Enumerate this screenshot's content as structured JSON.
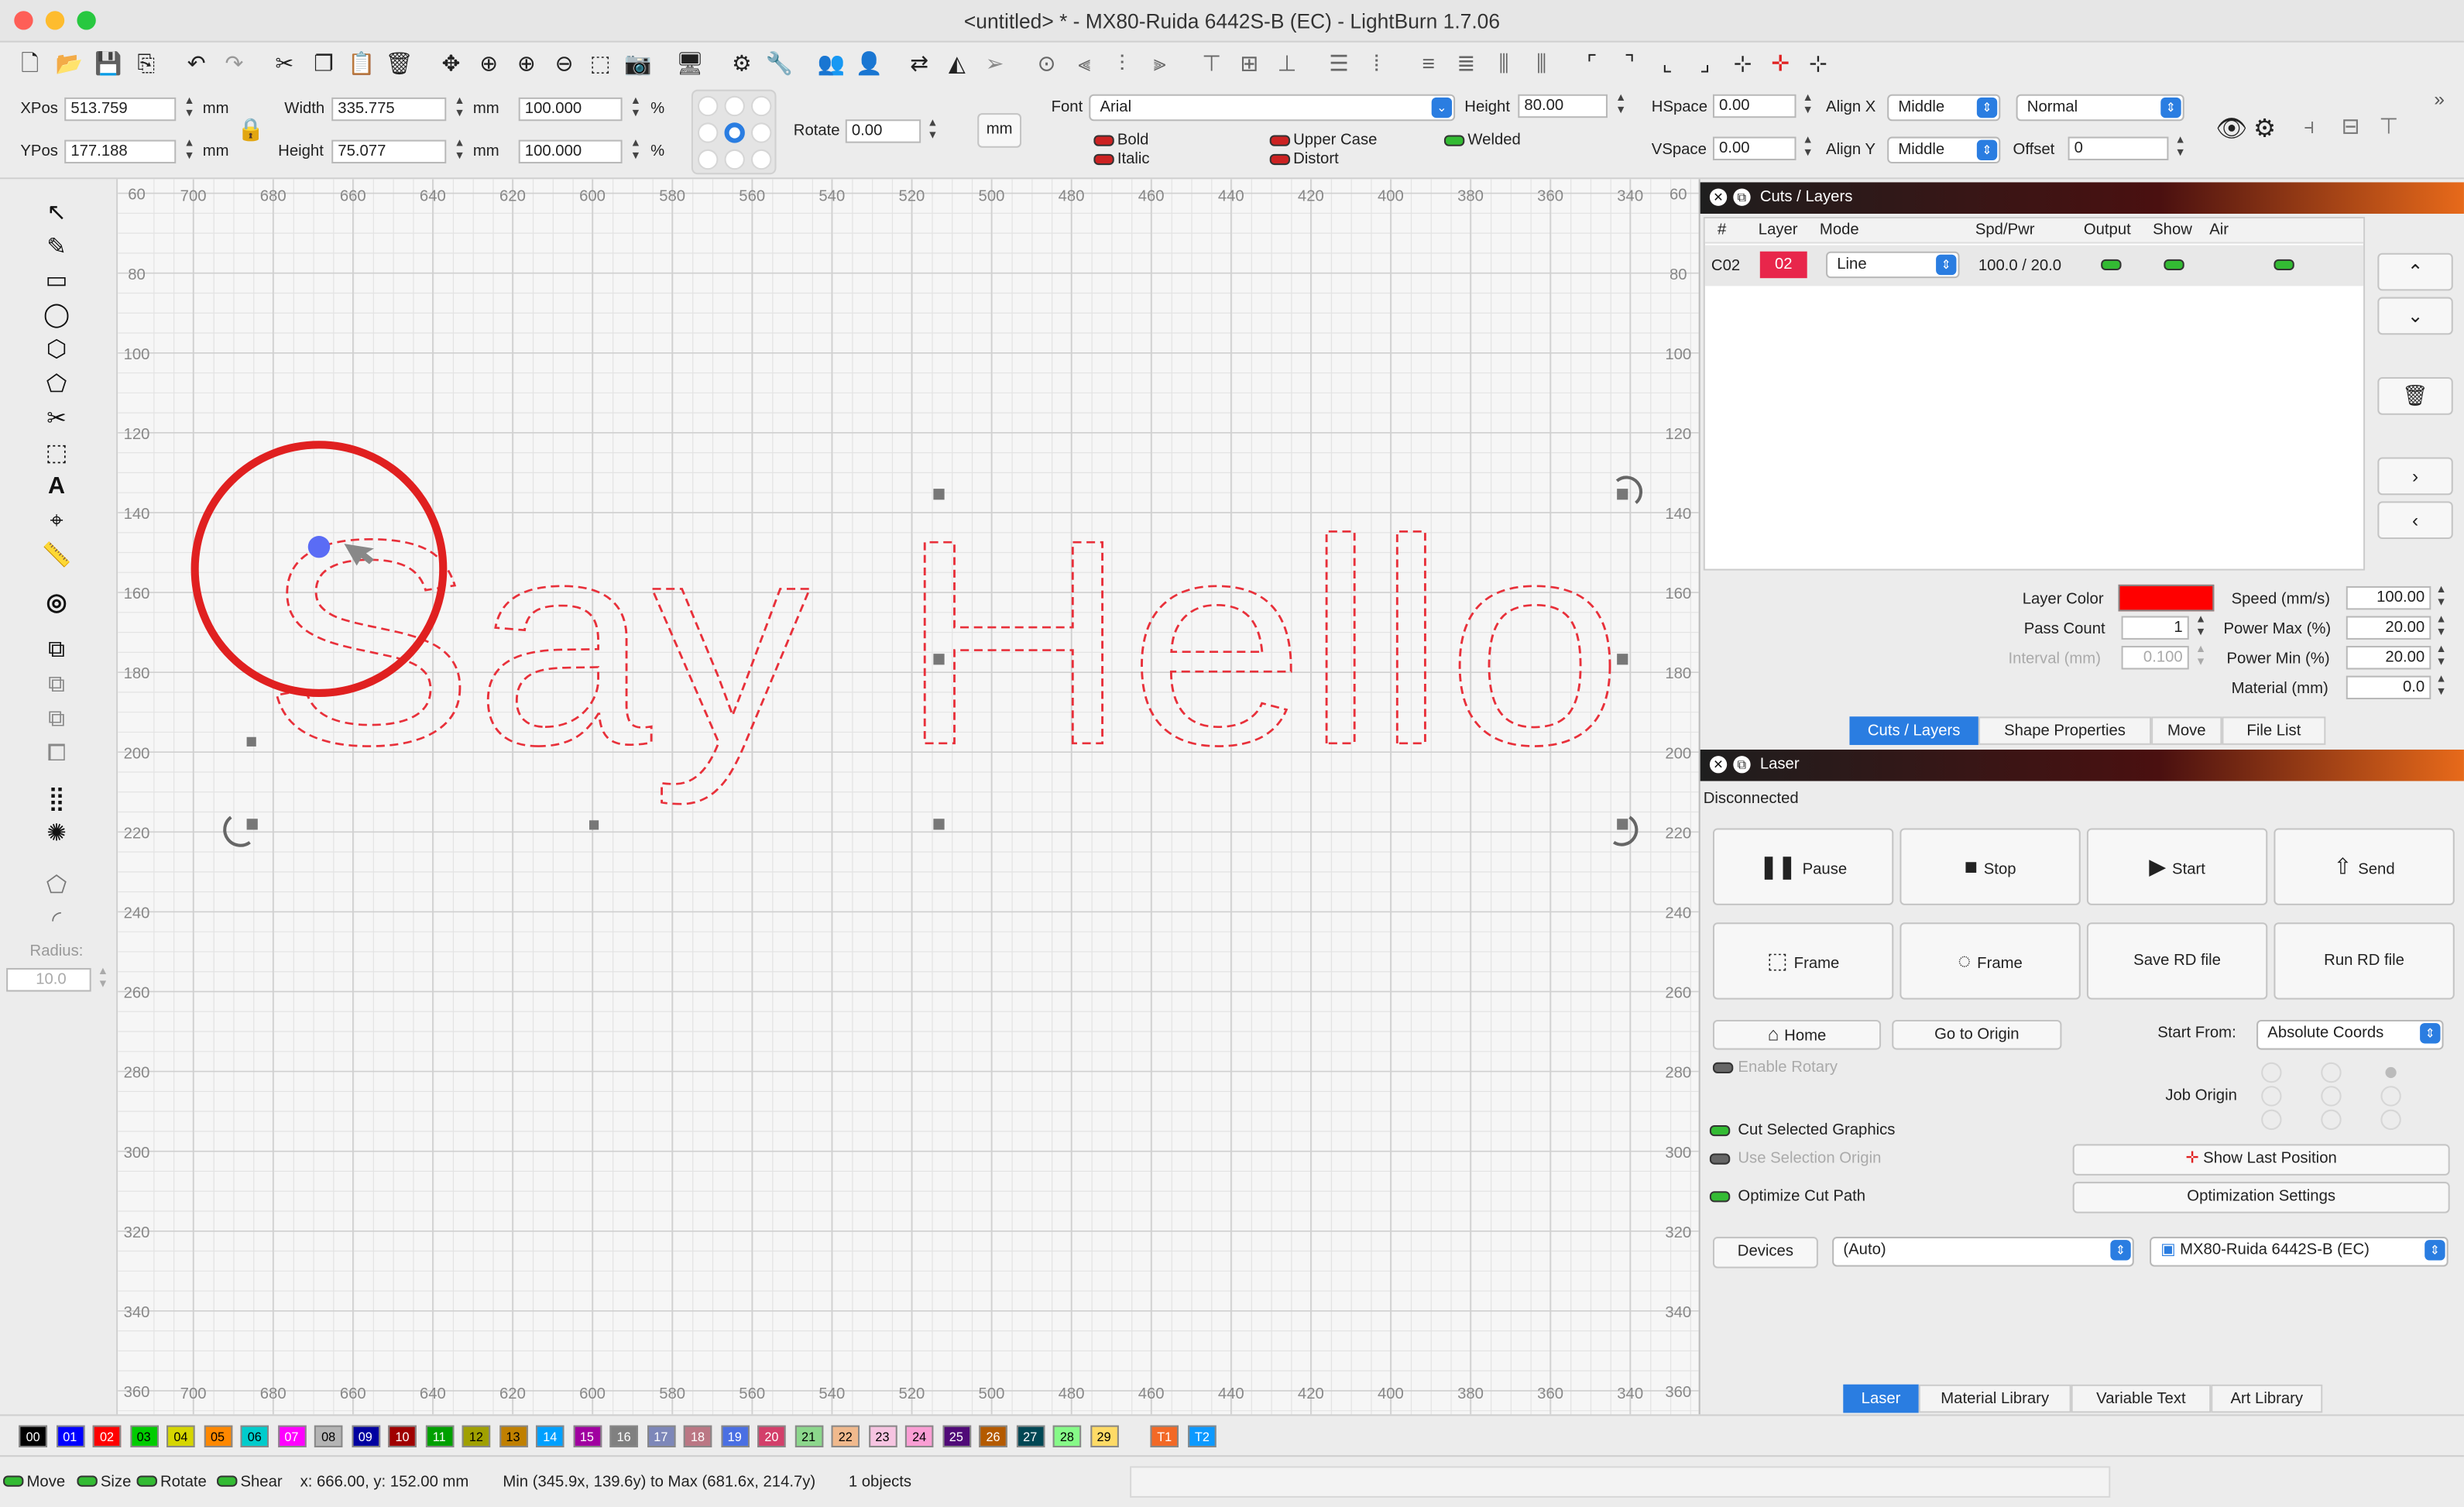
{
  "window": {
    "title": "<untitled> * - MX80-Ruida 6442S-B (EC) - LightBurn 1.7.06"
  },
  "props": {
    "xpos_label": "XPos",
    "xpos": "513.759",
    "ypos_label": "YPos",
    "ypos": "177.188",
    "unit": "mm",
    "width_label": "Width",
    "width": "335.775",
    "height_label": "Height",
    "height": "75.077",
    "scale_x": "100.000",
    "scale_y": "100.000",
    "percent": "%",
    "rotate_label": "Rotate",
    "rotate": "0.00",
    "mm_button": "mm",
    "font_label": "Font",
    "font": "Arial",
    "fheight_label": "Height",
    "fheight": "80.00",
    "hspace_label": "HSpace",
    "hspace": "0.00",
    "vspace_label": "VSpace",
    "vspace": "0.00",
    "alignx_label": "Align X",
    "alignx": "Middle",
    "aligny_label": "Align Y",
    "aligny": "Middle",
    "mode": "Normal",
    "offset_label": "Offset",
    "offset": "0",
    "bold": "Bold",
    "italic": "Italic",
    "upper": "Upper Case",
    "distort": "Distort",
    "welded": "Welded"
  },
  "left_tools": {
    "radius_label": "Radius:",
    "radius": "10.0"
  },
  "canvas": {
    "x_ticks": [
      "700",
      "680",
      "660",
      "640",
      "620",
      "600",
      "580",
      "560",
      "540",
      "520",
      "500",
      "480",
      "460",
      "440",
      "420",
      "400",
      "380",
      "360",
      "340"
    ],
    "y_ticks": [
      "60",
      "80",
      "100",
      "120",
      "140",
      "160",
      "180",
      "200",
      "220",
      "240",
      "260",
      "280",
      "300",
      "320",
      "340",
      "360"
    ],
    "text": "Say Hello",
    "text_color": "#e8303a",
    "highlight_color": "#e02020"
  },
  "cuts": {
    "title": "Cuts / Layers",
    "headers": [
      "#",
      "Layer",
      "Mode",
      "Spd/Pwr",
      "Output",
      "Show",
      "Air"
    ],
    "row": {
      "id": "C02",
      "layer": "02",
      "mode": "Line",
      "spdpwr": "100.0 / 20.0"
    },
    "layer_color_label": "Layer Color",
    "layer_color": "#ff0000",
    "pass_count_label": "Pass Count",
    "pass_count": "1",
    "interval_label": "Interval (mm)",
    "interval": "0.100",
    "speed_label": "Speed (mm/s)",
    "speed": "100.00",
    "pmax_label": "Power Max (%)",
    "pmax": "20.00",
    "pmin_label": "Power Min (%)",
    "pmin": "20.00",
    "material_label": "Material (mm)",
    "material": "0.0",
    "tabs": [
      "Cuts / Layers",
      "Shape Properties",
      "Move",
      "File List"
    ]
  },
  "laser": {
    "title": "Laser",
    "status": "Disconnected",
    "buttons": [
      "Pause",
      "Stop",
      "Start",
      "Send",
      "Frame",
      "Frame",
      "Save RD file",
      "Run RD file"
    ],
    "home": "Home",
    "go_origin": "Go to Origin",
    "start_from_label": "Start From:",
    "start_from": "Absolute Coords",
    "enable_rotary": "Enable Rotary",
    "job_origin": "Job Origin",
    "cut_selected": "Cut Selected Graphics",
    "use_selection_origin": "Use Selection Origin",
    "show_last": "Show Last Position",
    "optimize_path": "Optimize Cut Path",
    "opt_settings": "Optimization Settings",
    "devices": "Devices",
    "auto": "(Auto)",
    "device": "MX80-Ruida 6442S-B (EC)",
    "tabs": [
      "Laser",
      "Material Library",
      "Variable Text",
      "Art Library"
    ]
  },
  "palette": [
    {
      "l": "00",
      "c": "#000000",
      "t": "#fff"
    },
    {
      "l": "01",
      "c": "#0000ff",
      "t": "#fff"
    },
    {
      "l": "02",
      "c": "#ff0000",
      "t": "#fff"
    },
    {
      "l": "03",
      "c": "#00cc00",
      "t": "#000"
    },
    {
      "l": "04",
      "c": "#d6d600",
      "t": "#000"
    },
    {
      "l": "05",
      "c": "#ff8800",
      "t": "#000"
    },
    {
      "l": "06",
      "c": "#00cccc",
      "t": "#000"
    },
    {
      "l": "07",
      "c": "#ff00ff",
      "t": "#fff"
    },
    {
      "l": "08",
      "c": "#b4b4b4",
      "t": "#000"
    },
    {
      "l": "09",
      "c": "#0000a0",
      "t": "#fff"
    },
    {
      "l": "10",
      "c": "#a00000",
      "t": "#fff"
    },
    {
      "l": "11",
      "c": "#00a000",
      "t": "#fff"
    },
    {
      "l": "12",
      "c": "#a0a000",
      "t": "#000"
    },
    {
      "l": "13",
      "c": "#c08000",
      "t": "#000"
    },
    {
      "l": "14",
      "c": "#00a0ff",
      "t": "#fff"
    },
    {
      "l": "15",
      "c": "#a000a0",
      "t": "#fff"
    },
    {
      "l": "16",
      "c": "#808080",
      "t": "#fff"
    },
    {
      "l": "17",
      "c": "#7d87b9",
      "t": "#fff"
    },
    {
      "l": "18",
      "c": "#bb7784",
      "t": "#fff"
    },
    {
      "l": "19",
      "c": "#4a6fe3",
      "t": "#fff"
    },
    {
      "l": "20",
      "c": "#d33f6a",
      "t": "#fff"
    },
    {
      "l": "21",
      "c": "#8cd78c",
      "t": "#000"
    },
    {
      "l": "22",
      "c": "#f0b98d",
      "t": "#000"
    },
    {
      "l": "23",
      "c": "#f6c4e1",
      "t": "#000"
    },
    {
      "l": "24",
      "c": "#fa9ed4",
      "t": "#000"
    },
    {
      "l": "25",
      "c": "#500a78",
      "t": "#fff"
    },
    {
      "l": "26",
      "c": "#b45a00",
      "t": "#fff"
    },
    {
      "l": "27",
      "c": "#004754",
      "t": "#fff"
    },
    {
      "l": "28",
      "c": "#86fa88",
      "t": "#000"
    },
    {
      "l": "29",
      "c": "#ffdb66",
      "t": "#000"
    },
    {
      "l": "T1",
      "c": "#f36926",
      "t": "#fff"
    },
    {
      "l": "T2",
      "c": "#0c99ff",
      "t": "#fff"
    }
  ],
  "status": {
    "move": "Move",
    "size": "Size",
    "rotate": "Rotate",
    "shear": "Shear",
    "coords": "x: 666.00, y: 152.00 mm",
    "bounds": "Min (345.9x, 139.6y) to Max (681.6x, 214.7y)",
    "objects": "1 objects"
  }
}
